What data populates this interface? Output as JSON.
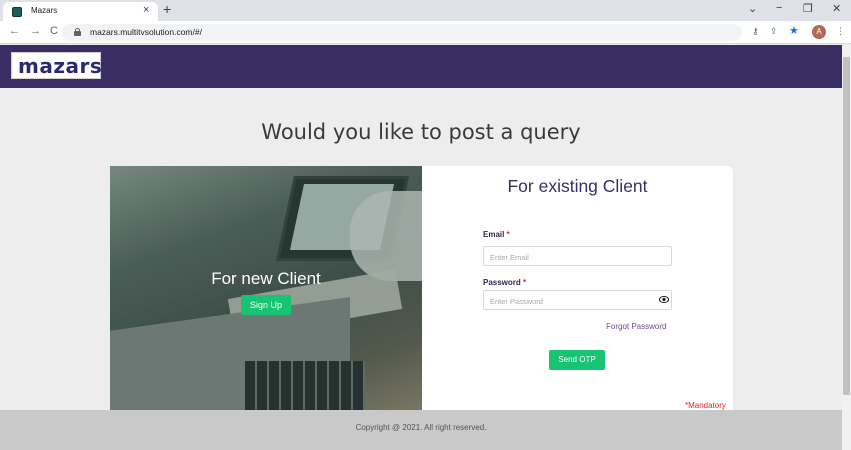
{
  "browser": {
    "tab_title": "Mazars",
    "tab_close": "×",
    "new_tab": "+",
    "url": "mazars.multitvsolution.com/#/",
    "controls": {
      "dropdown": "⌄",
      "minimize": "−",
      "restore": "❐",
      "close": "✕"
    },
    "nav": {
      "back": "←",
      "forward": "→",
      "reload": "C"
    },
    "icons": {
      "key": "⚷",
      "share": "⇪",
      "star": "★",
      "menu": "⋮"
    },
    "avatar_initial": "A"
  },
  "header": {
    "logo": "mazars",
    "brand_color": "#3b2e64"
  },
  "main": {
    "headline": "Would you like to post a query",
    "new_client": {
      "title": "For new Client",
      "signup_label": "Sign Up"
    },
    "existing_client": {
      "title": "For existing Client",
      "email_label": "Email",
      "email_placeholder": "Enter Email",
      "password_label": "Password",
      "password_placeholder": "Enter Password",
      "required_mark": "*",
      "forgot_password": "Forgot Password",
      "send_otp": "Send OTP",
      "mandatory_note": "*Mandatory"
    }
  },
  "footer": {
    "copyright": "Copyright @ 2021. All right reserved."
  },
  "colors": {
    "accent_green": "#18c372",
    "required_red": "#e32222"
  }
}
